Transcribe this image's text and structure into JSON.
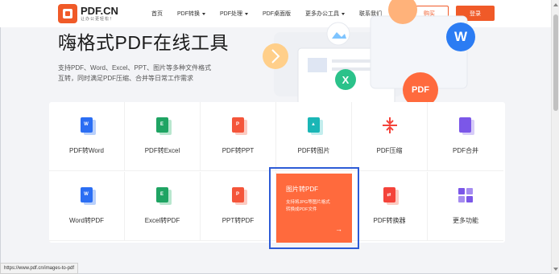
{
  "header": {
    "logo_name": "PDF.CN",
    "logo_slogan": "让办公更轻松！",
    "nav": [
      {
        "label": "首页",
        "dropdown": false
      },
      {
        "label": "PDF转换",
        "dropdown": true
      },
      {
        "label": "PDF处理",
        "dropdown": true
      },
      {
        "label": "PDF桌面版",
        "dropdown": false
      },
      {
        "label": "更多办公工具",
        "dropdown": true
      },
      {
        "label": "联系我们",
        "dropdown": false
      }
    ],
    "buy_label": "购买",
    "login_label": "登录"
  },
  "hero": {
    "title": "嗨格式PDF在线工具",
    "subtitle_line1": "支持PDF、Word、Excel、PPT、图片等多种文件格式",
    "subtitle_line2": "互转，同时满足PDF压缩、合并等日常工作需求"
  },
  "illustration": {
    "badges": [
      "W",
      "X",
      "PDF"
    ],
    "colors": {
      "word": "#2b7cf3",
      "excel": "#2bc28a",
      "pdf": "#ff6a3d"
    }
  },
  "tools": {
    "row1": [
      {
        "label": "PDF转Word",
        "icon": "word-doc-icon",
        "color": "#2b6ef3"
      },
      {
        "label": "PDF转Excel",
        "icon": "excel-doc-icon",
        "color": "#1fa463"
      },
      {
        "label": "PDF转PPT",
        "icon": "ppt-doc-icon",
        "color": "#f4553a"
      },
      {
        "label": "PDF转图片",
        "icon": "image-doc-icon",
        "color": "#1ab6b6"
      },
      {
        "label": "PDF压缩",
        "icon": "compress-icon",
        "color": "#f4433a"
      },
      {
        "label": "PDF合并",
        "icon": "merge-icon",
        "color": "#7b57e8"
      }
    ],
    "row2": [
      {
        "label": "Word转PDF",
        "icon": "word-doc-icon",
        "color": "#2b6ef3"
      },
      {
        "label": "Excel转PDF",
        "icon": "excel-doc-icon",
        "color": "#1fa463"
      },
      {
        "label": "PPT转PDF",
        "icon": "ppt-doc-icon",
        "color": "#f4553a"
      },
      {
        "label": "图片转PDF",
        "icon": "image-doc-icon",
        "color": "#ff6a3d"
      },
      {
        "label": "PDF转换器",
        "icon": "converter-icon",
        "color": "#f4433a"
      },
      {
        "label": "更多功能",
        "icon": "grid-icon",
        "color": "#7b57e8"
      }
    ],
    "featured": {
      "title": "图片转PDF",
      "desc_line1": "支持将JPG等图片格式",
      "desc_line2": "转换成PDF文件",
      "arrow": "→"
    }
  },
  "status_bar": {
    "url": "https://www.pdf.cn/images-to-pdf"
  }
}
